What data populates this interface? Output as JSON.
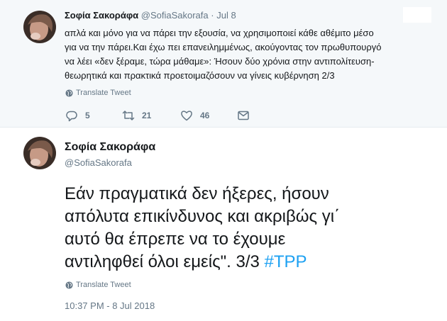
{
  "top_tweet": {
    "name": "Σοφία Σακοράφα",
    "handle": "@SofiaSakorafa",
    "separator": "·",
    "date": "Jul 8",
    "lines": [
      "απλά και μόνο για να πάρει την εξουσία, να χρησιμοποιεί κάθε αθέμιτο μέσο",
      "για να την πάρει.Και έχω πει επανειλημμένως, ακούγοντας τον πρωθυπουργό",
      "να λέει «δεν ξέραμε, τώρα μάθαμε»: Ήσουν δύο χρόνια στην αντιπολίτευση-",
      "θεωρητικά και πρακτικά προετοιμαζόσουν να γίνεις κυβέρνηση 2/3"
    ],
    "translate_label": "Translate Tweet",
    "replies": "5",
    "retweets": "21",
    "likes": "46"
  },
  "main_tweet": {
    "name": "Σοφία Σακοράφα",
    "handle": "@SofiaSakorafa",
    "lines": [
      "Εάν πραγματικά δεν ήξερες, ήσουν",
      "απόλυτα επικίνδυνος και ακριβώς γι΄",
      "αυτό θα έπρεπε να το έχουμε"
    ],
    "last_line_text": "αντιληφθεί όλοι εμείς\". 3/3 ",
    "hashtag": "#TPP",
    "translate_label": "Translate Tweet",
    "timestamp": "10:37 PM - 8 Jul 2018"
  },
  "colors": {
    "link": "#1da1f2",
    "secondary_text": "#657786",
    "primary_text": "#14171a",
    "top_background": "#f5f8fa"
  },
  "icons": [
    "globe-icon",
    "reply-icon",
    "retweet-icon",
    "heart-icon",
    "envelope-icon"
  ]
}
